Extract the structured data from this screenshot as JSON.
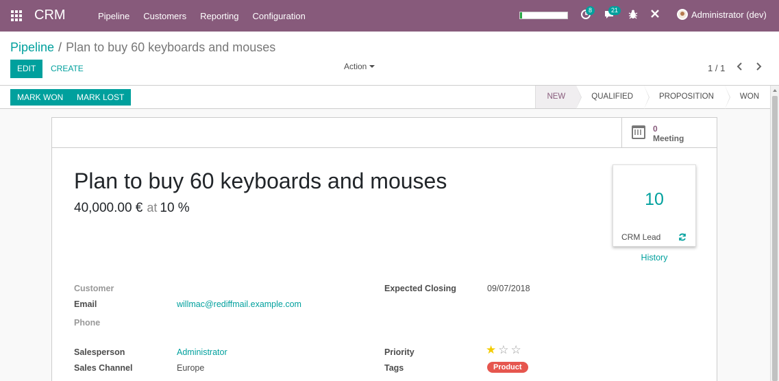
{
  "navbar": {
    "brand": "CRM",
    "menu": [
      "Pipeline",
      "Customers",
      "Reporting",
      "Configuration"
    ],
    "activity_count": "8",
    "message_count": "21",
    "user": "Administrator (dev)",
    "progress_fraction": 0.05
  },
  "control": {
    "breadcrumb_root": "Pipeline",
    "breadcrumb_sep": "/",
    "breadcrumb_current": "Plan to buy 60 keyboards and mouses",
    "edit_label": "Edit",
    "create_label": "Create",
    "action_label": "Action",
    "pager": "1 / 1"
  },
  "statusbar": {
    "mark_won": "Mark Won",
    "mark_lost": "Mark Lost",
    "stages": [
      {
        "label": "New",
        "active": true
      },
      {
        "label": "Qualified",
        "active": false
      },
      {
        "label": "Proposition",
        "active": false
      },
      {
        "label": "Won",
        "active": false
      }
    ]
  },
  "form": {
    "meeting_count": "0",
    "meeting_label": "Meeting",
    "title": "Plan to buy 60 keyboards and mouses",
    "revenue": "40,000.00 €",
    "at_label": "at",
    "probability": "10 %",
    "lead_count": "10",
    "lead_label": "CRM Lead",
    "history_label": "History",
    "left_fields": {
      "customer_label": "Customer",
      "email_label": "Email",
      "email_value": "willmac@rediffmail.example.com",
      "phone_label": "Phone",
      "salesperson_label": "Salesperson",
      "salesperson_value": "Administrator",
      "channel_label": "Sales Channel",
      "channel_value": "Europe"
    },
    "right_fields": {
      "closing_label": "Expected Closing",
      "closing_value": "09/07/2018",
      "priority_label": "Priority",
      "priority_value": 1,
      "priority_max": 3,
      "tags_label": "Tags",
      "tag_value": "Product"
    }
  },
  "colors": {
    "brand": "#875a7b",
    "accent": "#00a09d",
    "tag": "#e6564e",
    "star": "#f3cc00"
  }
}
